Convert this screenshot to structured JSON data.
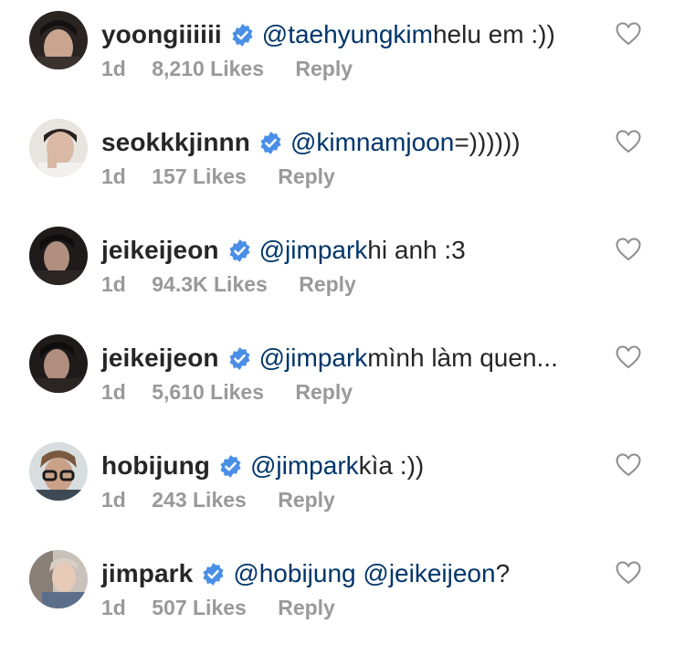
{
  "comments": [
    {
      "username": "yoongiiiiii",
      "mention": "@taehyungkim",
      "text": " helu em :))",
      "time": "1d",
      "likes": "8,210 Likes",
      "reply": "Reply"
    },
    {
      "username": "seokkkjinnn",
      "mention": "@kimnamjoon",
      "text": " =))))))",
      "time": "1d",
      "likes": "157 Likes",
      "reply": "Reply"
    },
    {
      "username": "jeikeijeon",
      "mention": "@jimpark",
      "text": " hi anh :3",
      "time": "1d",
      "likes": "94.3K Likes",
      "reply": "Reply"
    },
    {
      "username": "jeikeijeon",
      "mention": "@jimpark",
      "text": " mình làm quen...",
      "time": "1d",
      "likes": "5,610 Likes",
      "reply": "Reply"
    },
    {
      "username": "hobijung",
      "mention": "@jimpark",
      "text": " kìa :))",
      "time": "1d",
      "likes": "243 Likes",
      "reply": "Reply"
    },
    {
      "username": "jimpark",
      "mention": "@hobijung",
      "mention2": "@jeikeijeon",
      "text": " ?",
      "time": "1d",
      "likes": "507 Likes",
      "reply": "Reply"
    }
  ],
  "icons": {
    "verified": "verified-badge-icon",
    "like": "heart-outline-icon"
  },
  "colors": {
    "verified": "#4A8FE6",
    "mention": "#003569",
    "meta": "#999999",
    "heart_stroke": "#8e8e8e"
  }
}
